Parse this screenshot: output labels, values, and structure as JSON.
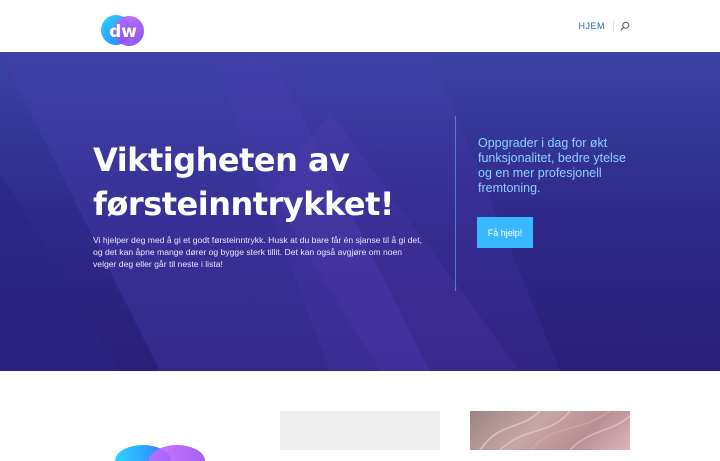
{
  "header": {
    "nav_home": "HJEM",
    "search_icon": "search-icon"
  },
  "hero": {
    "title": "Viktigheten av førsteinntrykket!",
    "text": "Vi hjelper deg med å gi et godt førsteinntrykk. Husk at du bare får én sjanse til å gi det, og det kan åpne mange dører og bygge sterk tillit. Det kan også avgjøre om noen velger deg eller går til neste i lista!",
    "side_text": "Oppgrader i dag for økt funksjonalitet, bedre ytelse og en mer profesjonell fremtoning.",
    "cta_label": "Få hjelp!"
  },
  "colors": {
    "accent": "#3ab8ff",
    "nav_text": "#2b6cb0",
    "hero_top": "#3a43a3",
    "hero_bottom": "#2a1f78",
    "side_text": "#8fd0ff"
  }
}
